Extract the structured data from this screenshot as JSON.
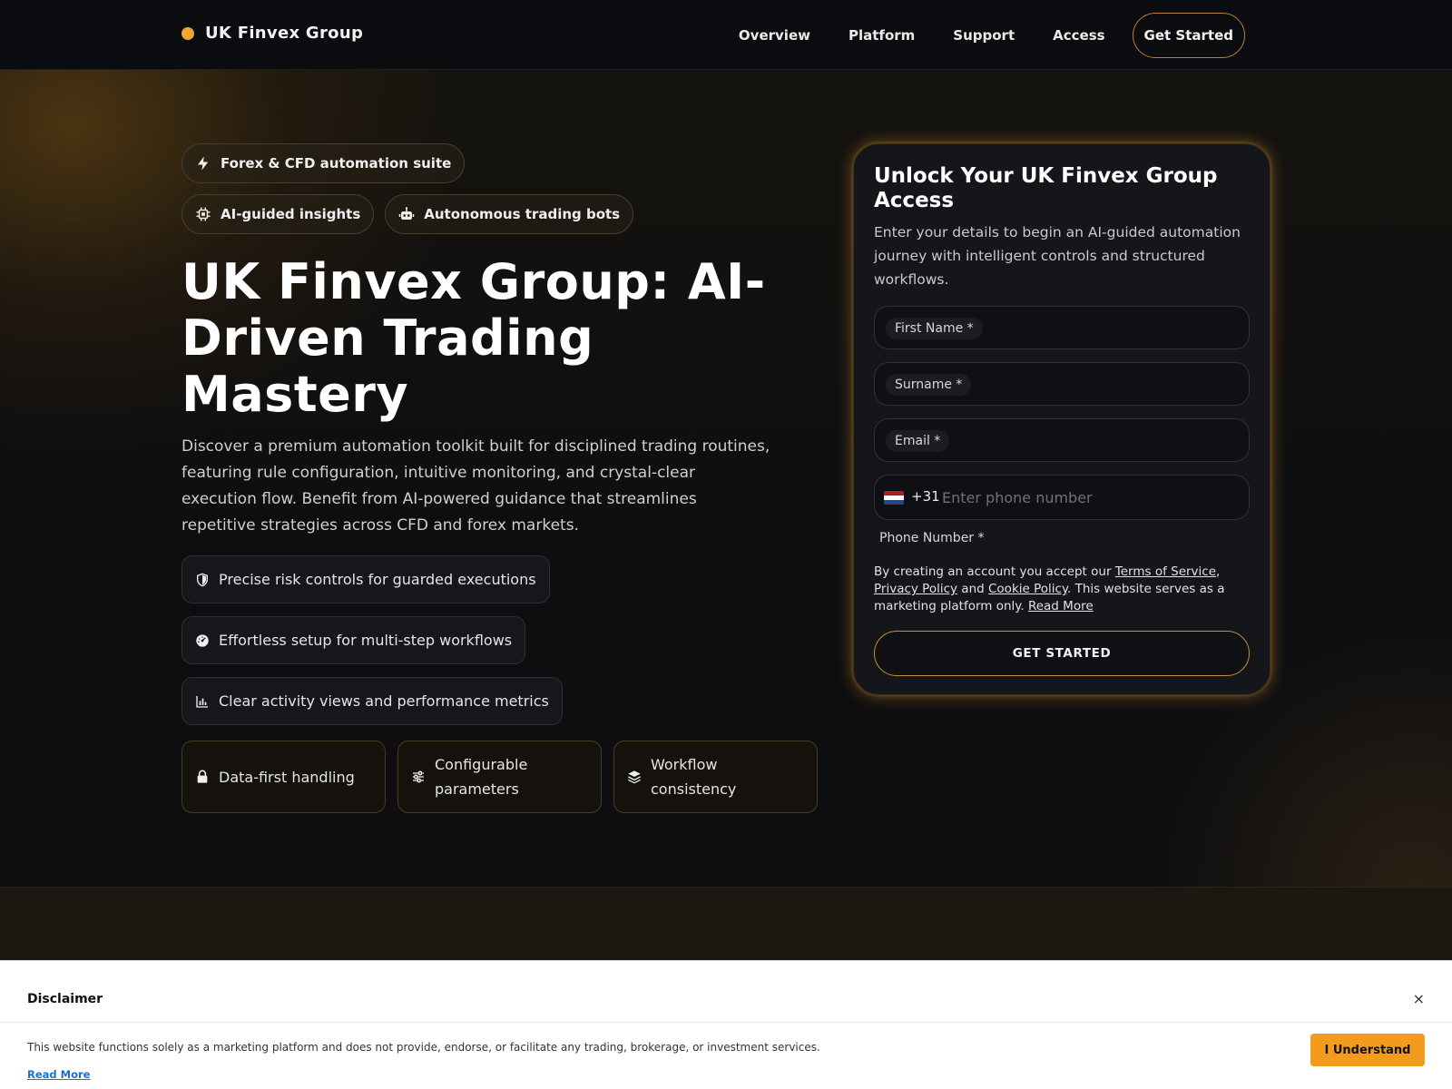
{
  "header": {
    "brand": "UK Finvex Group",
    "nav": [
      "Overview",
      "Platform",
      "Support",
      "Access"
    ],
    "cta": "Get Started"
  },
  "hero": {
    "badges": [
      {
        "label": "Forex & CFD automation suite",
        "icon": "bolt-icon"
      },
      {
        "label": "AI-guided insights",
        "icon": "chip-icon"
      },
      {
        "label": "Autonomous trading bots",
        "icon": "robot-icon"
      }
    ],
    "title": "UK Finvex Group: AI-Driven Trading Mastery",
    "description": "Discover a premium automation toolkit built for disciplined trading routines, featuring rule configuration, intuitive monitoring, and crystal-clear execution flow. Benefit from AI-powered guidance that streamlines repetitive strategies across CFD and forex markets.",
    "features": [
      {
        "label": "Precise risk controls for guarded executions",
        "icon": "shield-icon"
      },
      {
        "label": "Effortless setup for multi-step workflows",
        "icon": "gauge-icon"
      },
      {
        "label": "Clear activity views and performance metrics",
        "icon": "chart-icon"
      }
    ],
    "pillars": [
      {
        "label": "Data-first handling",
        "icon": "lock-icon"
      },
      {
        "label": "Configurable parameters",
        "icon": "sliders-icon"
      },
      {
        "label": "Workflow consistency",
        "icon": "layers-icon"
      }
    ]
  },
  "form": {
    "title": "Unlock Your UK Finvex Group Access",
    "subtitle": "Enter your details to begin an AI-guided automation journey with intelligent controls and structured workflows.",
    "first_name_label": "First Name *",
    "surname_label": "Surname *",
    "email_label": "Email *",
    "phone_code": "+31",
    "phone_placeholder": "Enter phone number",
    "phone_label": "Phone Number *",
    "terms": {
      "prefix": "By creating an account you accept our ",
      "tos": "Terms of Service",
      "comma": ",",
      "privacy": "Privacy Policy",
      "and": " and ",
      "cookie": "Cookie Policy",
      "suffix": ". This website serves as a marketing platform only. ",
      "read_more": "Read More"
    },
    "submit": "GET STARTED"
  },
  "disclaimer": {
    "title": "Disclaimer",
    "close": "×",
    "text": "This website functions solely as a marketing platform and does not provide, endorse, or facilitate any trading, brokerage, or investment services.",
    "read_more": "Read More",
    "button": "I Understand"
  },
  "colors": {
    "accent": "#f3a531",
    "button_orange": "#f29b1d",
    "link_blue": "#1b6fd0"
  }
}
